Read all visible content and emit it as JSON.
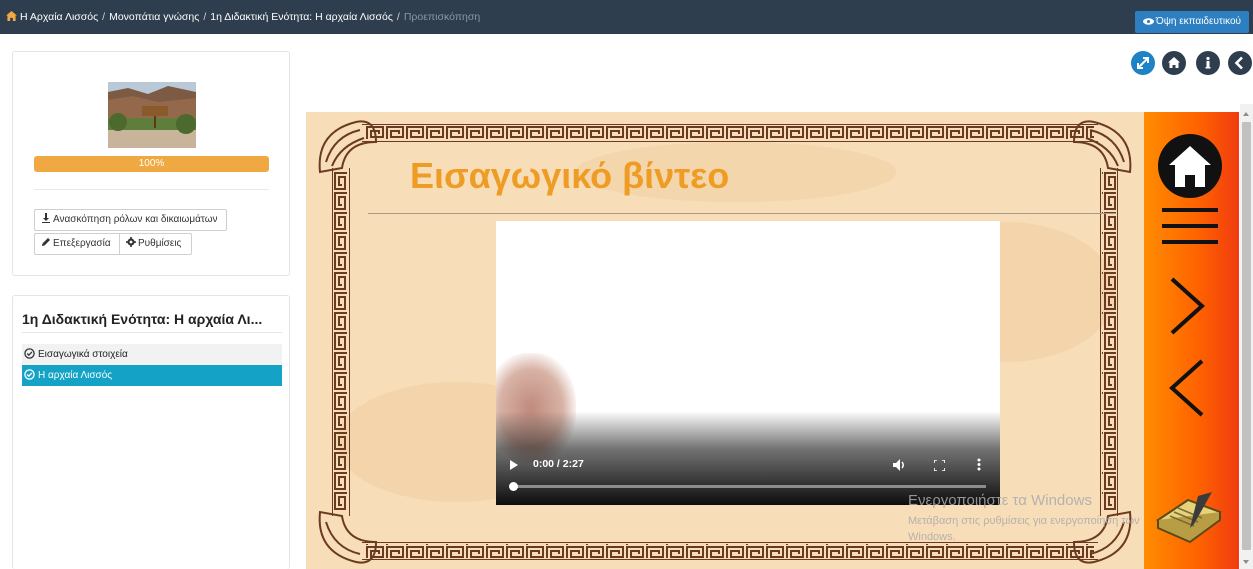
{
  "breadcrumb": {
    "items": [
      "Η Αρχαία Λισσός",
      "Μονοπάτια γνώσης",
      "1η Διδακτική Ενότητα: Η αρχαία Λισσός"
    ],
    "separator": "/",
    "current": "Προεπισκόπηση"
  },
  "header": {
    "teacher_view_label": "Όψη εκπαιδευτικού"
  },
  "course_card": {
    "progress_label": "100%",
    "roles_button": "Ανασκόπηση ρόλων και δικαιωμάτων",
    "edit_button": "Επεξεργασία",
    "settings_button": "Ρυθμίσεις"
  },
  "unit": {
    "title": "1η Διδακτική Ενότητα: Η αρχαία Λι...",
    "items": [
      {
        "label": "Εισαγωγικά στοιχεία",
        "active": false
      },
      {
        "label": "Η αρχαία Λισσός",
        "active": true
      }
    ]
  },
  "content": {
    "title": "Εισαγωγικό βίντεο",
    "video": {
      "time": "0:00 / 2:27",
      "progress": 0
    }
  },
  "watermark": {
    "line1": "Ενεργοποιήστε τα Windows",
    "line2": "Μετάβαση στις ρυθμίσεις για ενεργοποίηση των",
    "line3": "Windows."
  },
  "colors": {
    "topbar": "#2f3e4e",
    "accent_blue": "#2d7fc1",
    "progress": "#f0a843",
    "active_item": "#14a3c7",
    "title_orange": "#ef9c24",
    "nav_bar_orange": "#ff6400"
  },
  "icons": [
    "home-icon",
    "eye-icon",
    "download-icon",
    "pencil-icon",
    "gear-icon",
    "check-circle-icon",
    "expand-icon",
    "info-icon",
    "back-icon",
    "menu-icon",
    "next-icon",
    "prev-icon",
    "play-icon",
    "volume-icon",
    "fullscreen-icon",
    "more-icon",
    "notebook-icon"
  ]
}
